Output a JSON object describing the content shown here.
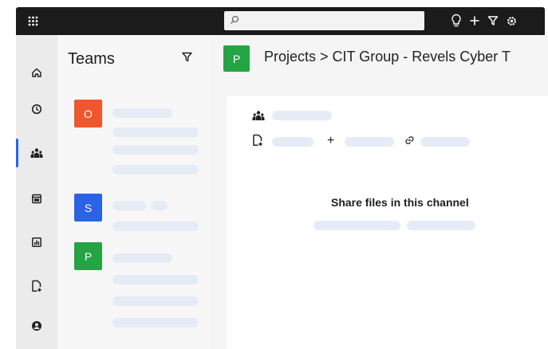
{
  "search": {
    "placeholder": ""
  },
  "teams": {
    "title": "Teams",
    "items": [
      {
        "initial": "O",
        "color": "#f0562d"
      },
      {
        "initial": "S",
        "color": "#2a63e6"
      },
      {
        "initial": "P",
        "color": "#25a444"
      }
    ]
  },
  "channel": {
    "initial": "P",
    "color": "#25a444",
    "breadcrumb": "Projects > CIT Group - Revels Cyber T"
  },
  "files": {
    "empty_title": "Share files in this channel",
    "add_symbol": "+"
  },
  "colors": {
    "topbar": "#1b1b1b",
    "accent": "#2a63e6",
    "skeleton": "#e6ecf5"
  }
}
